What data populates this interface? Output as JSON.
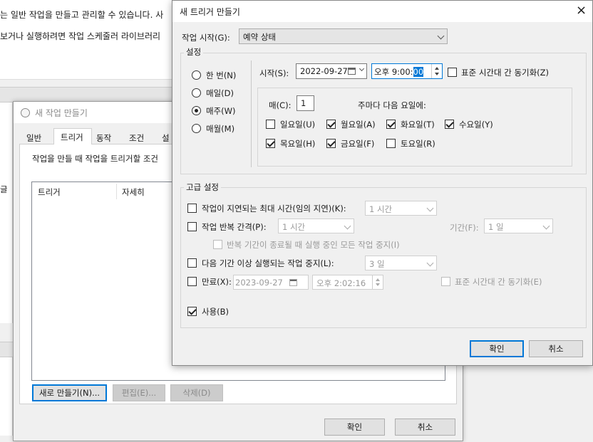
{
  "background_window": {
    "line1": "는 일반 작업을 만들고 관리할 수 있습니다. 사",
    "line2": "보거나 실행하려면 작업 스케줄러 라이브러리",
    "side_label": "글"
  },
  "create_task": {
    "title": "새 작업 만들기",
    "tabs": [
      "일반",
      "트리거",
      "동작",
      "조건",
      "설"
    ],
    "description": "작업을 만들 때 작업을 트리거할 조건",
    "columns": [
      "트리거",
      "자세히"
    ],
    "new_button": "새로 만들기(N)...",
    "edit_button": "편집(E)...",
    "delete_button": "삭제(D)",
    "ok_button": "확인",
    "cancel_button": "취소"
  },
  "new_trigger": {
    "title": "새 트리거 만들기",
    "close": "×",
    "begin_label": "작업 시작(G):",
    "begin_value": "예약 상태",
    "settings_label": "설정",
    "frequency_options": [
      "한 번(N)",
      "매일(D)",
      "매주(W)",
      "매월(M)"
    ],
    "frequency_selected": "매주(W)",
    "start_label": "시작(S):",
    "start_date": "2022-09-27",
    "start_time_prefix": "오후  9:00:",
    "start_time_selected": "00",
    "sync_timezone": "표준 시간대 간 동기화(Z)",
    "recur_label": "매(C):",
    "recur_value": "1",
    "recur_suffix": "주마다 다음 요일에:",
    "days": [
      {
        "label": "일요일(U)",
        "checked": false
      },
      {
        "label": "월요일(A)",
        "checked": true
      },
      {
        "label": "화요일(T)",
        "checked": true
      },
      {
        "label": "수요일(Y)",
        "checked": true
      },
      {
        "label": "목요일(H)",
        "checked": true
      },
      {
        "label": "금요일(F)",
        "checked": true
      },
      {
        "label": "토요일(R)",
        "checked": false
      }
    ],
    "advanced_label": "고급 설정",
    "delay_label": "작업이 지연되는 최대 시간(임의 지연)(K):",
    "delay_value": "1 시간",
    "repeat_label": "작업 반복 간격(P):",
    "repeat_value": "1 시간",
    "duration_label": "기간(F):",
    "duration_value": "1 일",
    "stop_running_label": "반복 기간이 종료될 때 실행 중인 모든 작업 중지(I)",
    "stop_longer_label": "다음 기간 이상 실행되는 작업 중지(L):",
    "stop_longer_value": "3 일",
    "expire_label": "만료(X):",
    "expire_date": "2023-09-27",
    "expire_time": "오후  2:02:16",
    "expire_sync": "표준 시간대 간 동기화(E)",
    "enabled_label": "사용(B)",
    "ok_button": "확인",
    "cancel_button": "취소"
  }
}
